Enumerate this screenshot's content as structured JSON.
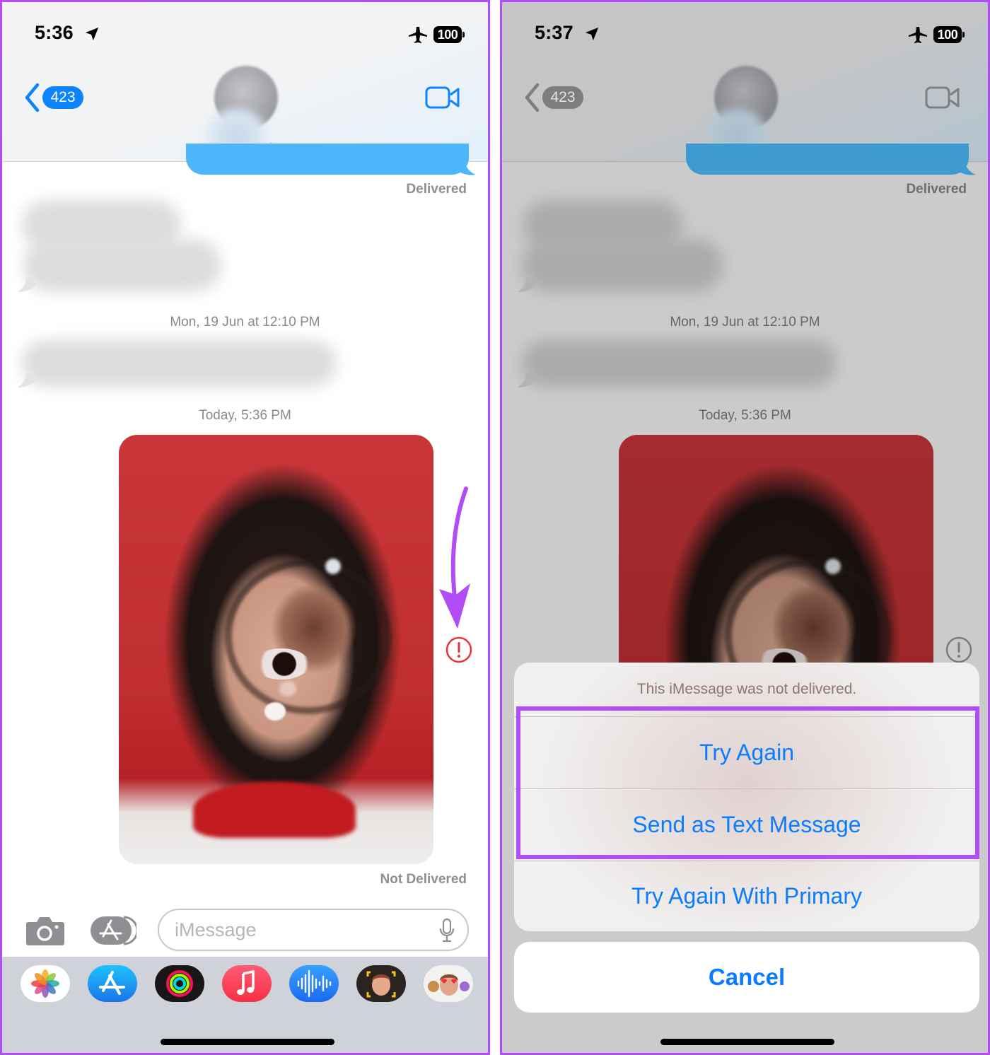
{
  "colors": {
    "annotation_purple": "#b14cf7",
    "ios_blue": "#0a7cff",
    "error_red": "#e8323a",
    "sent_bubble": "#4db6fa"
  },
  "left_screen": {
    "status_bar": {
      "time": "5:36",
      "location_icon": "location-arrow-icon",
      "airplane_icon": "airplane-icon",
      "battery": "100"
    },
    "nav": {
      "back_badge": "423",
      "back_icon": "chevron-left-icon",
      "video_icon": "video-camera-icon",
      "contact_chevron": "›"
    },
    "conversation": {
      "delivered_label": "Delivered",
      "timestamp_1": "Mon, 19 Jun at 12:10 PM",
      "timestamp_2": "Today, 5:36 PM",
      "not_delivered_label": "Not Delivered",
      "alert_icon": "exclamation-circle-icon"
    },
    "input_bar": {
      "camera_icon": "camera-icon",
      "apps_icon": "app-store-icon",
      "placeholder": "iMessage",
      "mic_icon": "microphone-icon"
    },
    "app_tray": [
      {
        "name": "Photos",
        "icon": "photos-icon"
      },
      {
        "name": "App Store",
        "icon": "app-store-icon"
      },
      {
        "name": "Activity",
        "icon": "activity-rings-icon"
      },
      {
        "name": "Music",
        "icon": "music-note-icon"
      },
      {
        "name": "Audio Message",
        "icon": "waveform-icon"
      },
      {
        "name": "Memoji",
        "icon": "memoji-icon"
      },
      {
        "name": "Memoji Stickers",
        "icon": "memoji-stickers-icon"
      }
    ]
  },
  "right_screen": {
    "status_bar": {
      "time": "5:37",
      "battery": "100"
    },
    "nav": {
      "back_badge": "423"
    },
    "conversation": {
      "delivered_label": "Delivered",
      "timestamp_1": "Mon, 19 Jun at 12:10 PM",
      "timestamp_2": "Today, 5:36 PM"
    },
    "action_sheet": {
      "title": "This iMessage was not delivered.",
      "options": [
        "Try Again",
        "Send as Text Message",
        "Try Again With Primary"
      ],
      "cancel": "Cancel"
    }
  }
}
